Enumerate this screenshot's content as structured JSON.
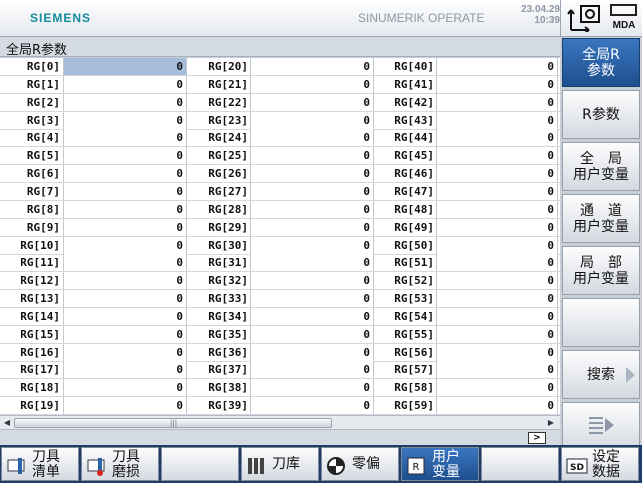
{
  "header": {
    "brand": "SIEMENS",
    "product": "SINUMERIK OPERATE",
    "date": "23.04.29",
    "time": "10:39",
    "mode": "MDA"
  },
  "title": "全局R参数",
  "columns": [
    {
      "labels": [
        "RG[0]",
        "RG[1]",
        "RG[2]",
        "RG[3]",
        "RG[4]",
        "RG[5]",
        "RG[6]",
        "RG[7]",
        "RG[8]",
        "RG[9]",
        "RG[10]",
        "RG[11]",
        "RG[12]",
        "RG[13]",
        "RG[14]",
        "RG[15]",
        "RG[16]",
        "RG[17]",
        "RG[18]",
        "RG[19]"
      ],
      "values": [
        "0",
        "0",
        "0",
        "0",
        "0",
        "0",
        "0",
        "0",
        "0",
        "0",
        "0",
        "0",
        "0",
        "0",
        "0",
        "0",
        "0",
        "0",
        "0",
        "0"
      ]
    },
    {
      "labels": [
        "RG[20]",
        "RG[21]",
        "RG[22]",
        "RG[23]",
        "RG[24]",
        "RG[25]",
        "RG[26]",
        "RG[27]",
        "RG[28]",
        "RG[29]",
        "RG[30]",
        "RG[31]",
        "RG[32]",
        "RG[33]",
        "RG[34]",
        "RG[35]",
        "RG[36]",
        "RG[37]",
        "RG[38]",
        "RG[39]"
      ],
      "values": [
        "0",
        "0",
        "0",
        "0",
        "0",
        "0",
        "0",
        "0",
        "0",
        "0",
        "0",
        "0",
        "0",
        "0",
        "0",
        "0",
        "0",
        "0",
        "0",
        "0"
      ]
    },
    {
      "labels": [
        "RG[40]",
        "RG[41]",
        "RG[42]",
        "RG[43]",
        "RG[44]",
        "RG[45]",
        "RG[46]",
        "RG[47]",
        "RG[48]",
        "RG[49]",
        "RG[50]",
        "RG[51]",
        "RG[52]",
        "RG[53]",
        "RG[54]",
        "RG[55]",
        "RG[56]",
        "RG[57]",
        "RG[58]",
        "RG[59]"
      ],
      "values": [
        "0",
        "0",
        "0",
        "0",
        "0",
        "0",
        "0",
        "0",
        "0",
        "0",
        "0",
        "0",
        "0",
        "0",
        "0",
        "0",
        "0",
        "0",
        "0",
        "0"
      ]
    }
  ],
  "selected_cell": "RG[0]",
  "pager": {
    "next_label": ">"
  },
  "vertical_softkeys": [
    {
      "label": "全局R\n参数",
      "active": true
    },
    {
      "label": "R参数",
      "active": false
    },
    {
      "label": "全　局\n用户变量",
      "active": false
    },
    {
      "label": "通　道\n用户变量",
      "active": false
    },
    {
      "label": "局　部\n用户变量",
      "active": false
    },
    {
      "label": "",
      "active": false
    },
    {
      "label": "搜索",
      "active": false,
      "arrow": true
    },
    {
      "label": "",
      "active": false,
      "icon": "list-arrow-icon"
    }
  ],
  "horizontal_softkeys": [
    {
      "label": "刀具\n清单",
      "icon": "tool-list-icon",
      "active": false
    },
    {
      "label": "刀具\n磨损",
      "icon": "tool-wear-icon",
      "active": false
    },
    {
      "label": "",
      "icon": "",
      "active": false
    },
    {
      "label": "刀库",
      "icon": "magazine-icon",
      "active": false
    },
    {
      "label": "零偏",
      "icon": "work-offset-icon",
      "active": false
    },
    {
      "label": "用户\n变量",
      "icon": "r-variable-icon",
      "active": true
    },
    {
      "label": "",
      "icon": "",
      "active": false
    },
    {
      "label": "设定\n数据",
      "icon": "setting-data-icon",
      "active": false
    }
  ],
  "colors": {
    "brand": "#138c9a",
    "active_key": "#2a63a8",
    "selected_cell": "#a6bdd9",
    "softkey_bar": "#1f3e6b"
  }
}
